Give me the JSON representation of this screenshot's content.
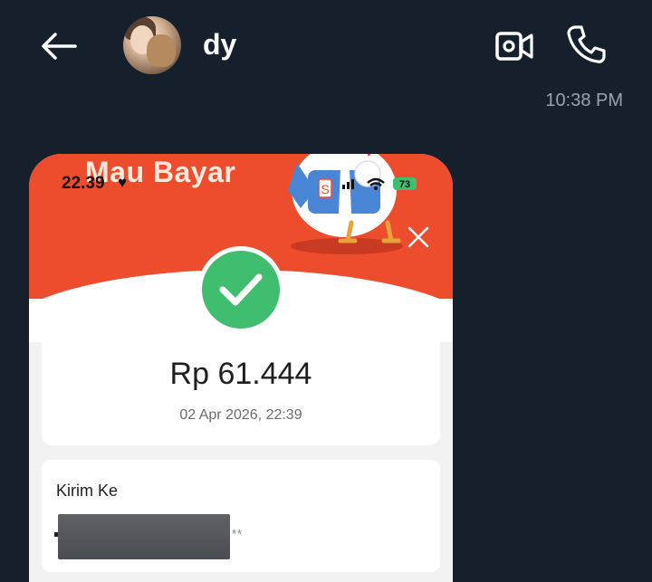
{
  "header": {
    "contact_name": "dy",
    "back_icon": "arrow-left-icon",
    "video_icon": "video-camera-icon",
    "call_icon": "phone-icon"
  },
  "chat": {
    "timestamp": "10:38 PM"
  },
  "image": {
    "phone_status_time": "22.39",
    "heart": "♥",
    "battery": "73",
    "banner_title": "Mau Bayar",
    "amount": "Rp 61.444",
    "datetime": "02 Apr 2026, 22:39",
    "send_label": "Kirim Ke",
    "masked_suffix": "**",
    "colors": {
      "banner": "#ee4d2d",
      "success": "#3ebe6e"
    }
  }
}
